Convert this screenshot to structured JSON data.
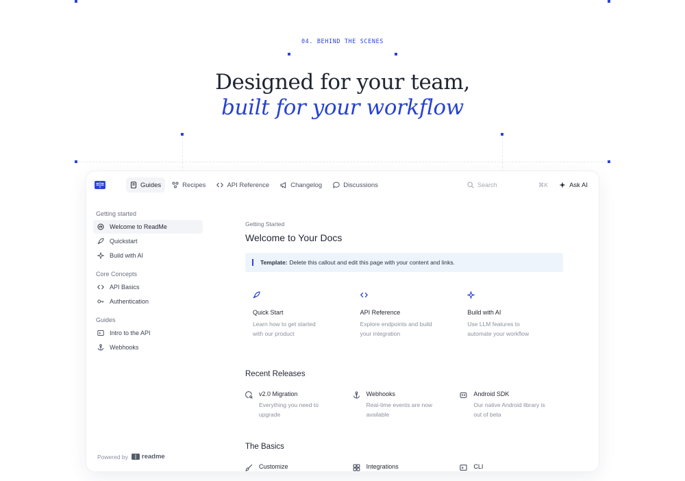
{
  "hero": {
    "eyebrow": "04. BEHIND THE SCENES",
    "headline_line1": "Designed for your team,",
    "headline_line2": "built for your workflow"
  },
  "colors": {
    "accent": "#2b44d6",
    "callout_bg": "#eef4fc"
  },
  "topbar": {
    "nav": [
      {
        "label": "Guides",
        "icon": "book-icon",
        "active": true
      },
      {
        "label": "Recipes",
        "icon": "recipes-icon"
      },
      {
        "label": "API Reference",
        "icon": "code-icon"
      },
      {
        "label": "Changelog",
        "icon": "megaphone-icon"
      },
      {
        "label": "Discussions",
        "icon": "chat-bubble-icon"
      }
    ],
    "search_placeholder": "Search",
    "search_shortcut": "⌘K",
    "ask_ai": "Ask AI"
  },
  "sidebar": {
    "groups": [
      {
        "title": "Getting started",
        "items": [
          "Welcome to ReadMe",
          "Quickstart",
          "Build with AI"
        ]
      },
      {
        "title": "Core Concepts",
        "items": [
          "API Basics",
          "Authentication"
        ]
      },
      {
        "title": "Guides",
        "items": [
          "Intro to the API",
          "Webhooks"
        ]
      }
    ],
    "powered_by": "Powered by",
    "brand": "readme"
  },
  "main": {
    "breadcrumb": "Getting Started",
    "title": "Welcome to Your Docs",
    "callout_label": "Template:",
    "callout_text": "Delete this callout and edit this page with your content and links.",
    "cards": [
      {
        "title": "Quick Start",
        "desc": "Learn how to get started with our product"
      },
      {
        "title": "API Reference",
        "desc": "Explore endpoints and build your integration"
      },
      {
        "title": "Build with AI",
        "desc": "Use LLM features to automate your workflow"
      }
    ],
    "recent_releases_title": "Recent Releases",
    "releases": [
      {
        "title": "v2.0 Migration",
        "desc": "Everything you need to upgrade"
      },
      {
        "title": "Webhooks",
        "desc": "Real-time events are now available"
      },
      {
        "title": "Android SDK",
        "desc": "Our native Android library is out of beta"
      }
    ],
    "basics_title": "The Basics",
    "basics": [
      {
        "title": "Customize"
      },
      {
        "title": "Integrations"
      },
      {
        "title": "CLI"
      }
    ]
  }
}
